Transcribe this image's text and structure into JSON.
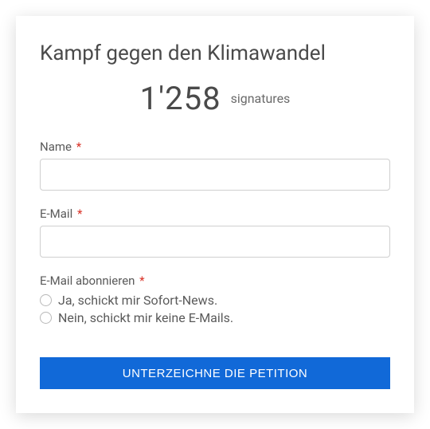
{
  "title": "Kampf gegen den Klimawandel",
  "signatures": {
    "count": "1'258",
    "label": "signatures"
  },
  "fields": {
    "name": {
      "label": "Name",
      "value": ""
    },
    "email": {
      "label": "E-Mail",
      "value": ""
    },
    "subscribe": {
      "label": "E-Mail abonnieren",
      "options": [
        "Ja, schickt mir Sofort-News.",
        "Nein, schickt mir keine E-Mails."
      ]
    }
  },
  "required_marker": "*",
  "submit_label": "UNTERZEICHNE DIE PETITION"
}
